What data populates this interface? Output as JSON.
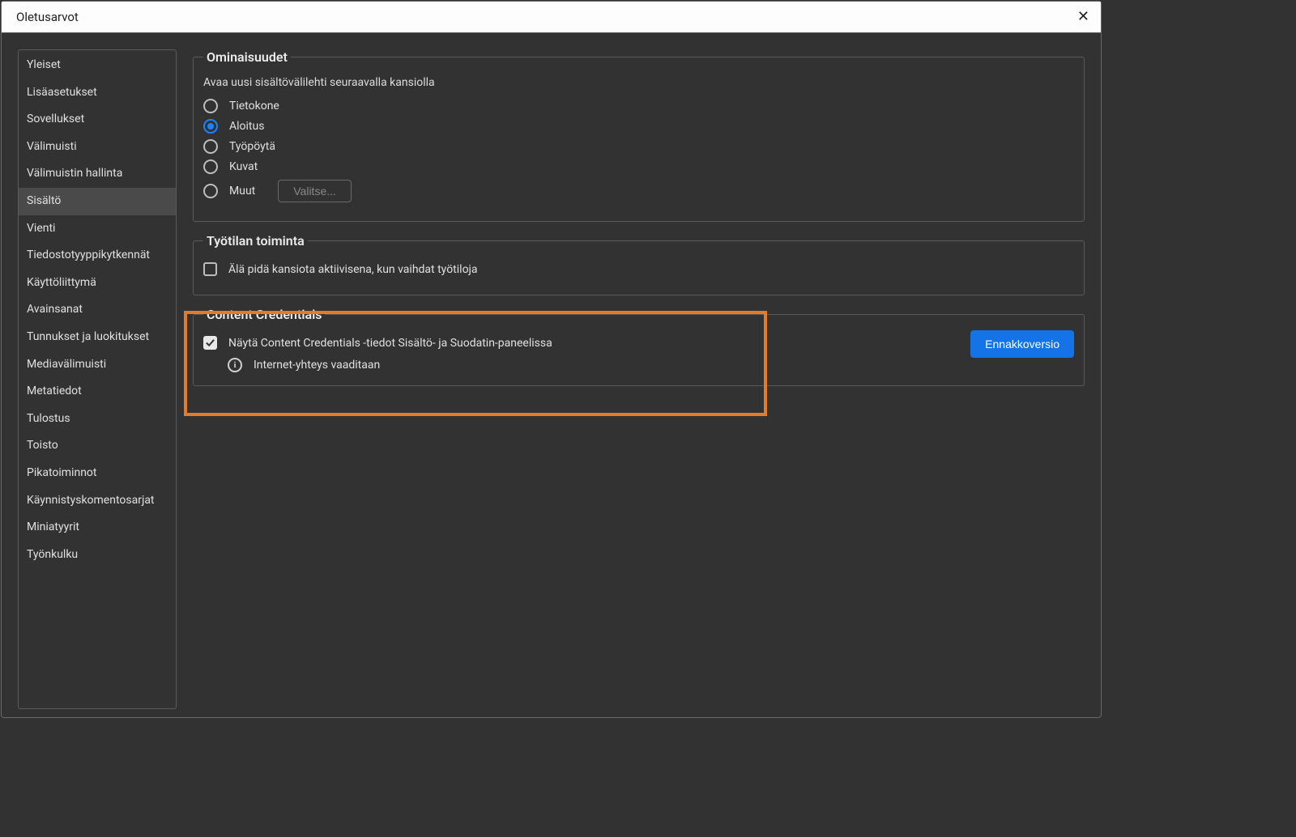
{
  "dialog": {
    "title": "Oletusarvot"
  },
  "sidebar": {
    "items": [
      {
        "label": "Yleiset"
      },
      {
        "label": "Lisäasetukset"
      },
      {
        "label": "Sovellukset"
      },
      {
        "label": "Välimuisti"
      },
      {
        "label": "Välimuistin hallinta"
      },
      {
        "label": "Sisältö"
      },
      {
        "label": "Vienti"
      },
      {
        "label": "Tiedostotyyppikytkennät"
      },
      {
        "label": "Käyttöliittymä"
      },
      {
        "label": "Avainsanat"
      },
      {
        "label": "Tunnukset ja luokitukset"
      },
      {
        "label": "Mediavälimuisti"
      },
      {
        "label": "Metatiedot"
      },
      {
        "label": "Tulostus"
      },
      {
        "label": "Toisto"
      },
      {
        "label": "Pikatoiminnot"
      },
      {
        "label": "Käynnistyskomentosarjat"
      },
      {
        "label": "Miniatyyrit"
      },
      {
        "label": "Työnkulku"
      }
    ],
    "activeIndex": 5
  },
  "properties": {
    "legend": "Ominaisuudet",
    "subtitle": "Avaa uusi sisältövälilehti seuraavalla kansiolla",
    "options": [
      {
        "label": "Tietokone"
      },
      {
        "label": "Aloitus"
      },
      {
        "label": "Työpöytä"
      },
      {
        "label": "Kuvat"
      },
      {
        "label": "Muut"
      }
    ],
    "selectedIndex": 1,
    "selectButton": "Valitse..."
  },
  "workspace": {
    "legend": "Työtilan toiminta",
    "checkbox": {
      "label": "Älä pidä kansiota aktiivisena, kun vaihdat työtiloja",
      "checked": false
    }
  },
  "contentCredentials": {
    "legend": "Content Credentials",
    "checkbox": {
      "label": "Näytä Content Credentials -tiedot Sisältö- ja Suodatin-paneelissa",
      "checked": true
    },
    "infoText": "Internet-yhteys vaaditaan",
    "previewButton": "Ennakkoversio"
  }
}
